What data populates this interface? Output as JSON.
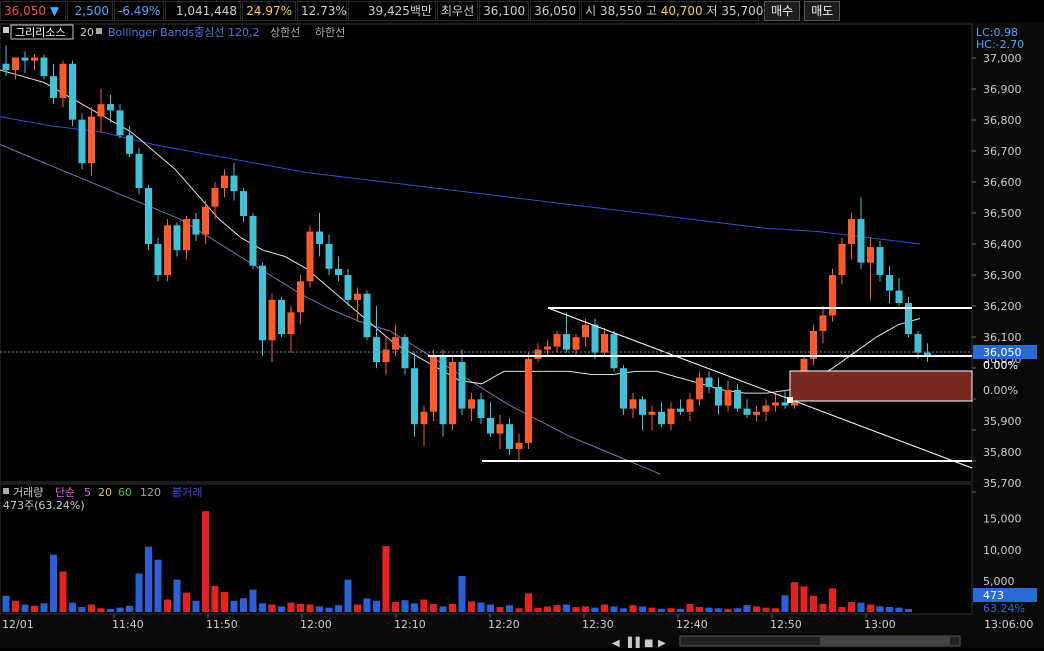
{
  "quote": {
    "price": "36,050",
    "arrow": "▼",
    "change": "2,500",
    "change_pct": "-6.49%",
    "volume": "1,041,448",
    "ratio1": "24.97%",
    "ratio2": "12.73%",
    "amount": "39,425백만",
    "best_label": "최우선",
    "best_ask": "36,100",
    "best_bid": "36,050",
    "open_label": "시",
    "open": "38,550",
    "high_label": "고",
    "high": "40,700",
    "low_label": "저",
    "low": "35,700",
    "buy_button": "매수",
    "sell_button": "매도"
  },
  "indicator_bar": {
    "menu_icon": "square-menu-icon",
    "name": "그리리소스",
    "period": "20",
    "bollinger_label": "Bollinger Bands중심선 120,2",
    "upper_label": "상한선",
    "lower_label": "하한선"
  },
  "right_info": {
    "lc": "LC:0.98",
    "hc": "HC:-2.70"
  },
  "price_axis": [
    "37,000",
    "36,900",
    "36,800",
    "36,700",
    "36,600",
    "36,500",
    "36,400",
    "36,300",
    "36,200",
    "36,100",
    "36,050",
    "0.00%",
    "35,900",
    "35,800",
    "35,700"
  ],
  "current_price_tag": "36,050",
  "current_pct_tag": "0.00%",
  "volume_panel": {
    "title": "거래량",
    "ma_label": "단순",
    "ma5": "5",
    "ma20": "20",
    "ma60": "60",
    "ma120": "120",
    "extra": "불거래",
    "current": "473주(63.24%)",
    "axis": [
      "15,000",
      "10,000",
      "5,000"
    ],
    "tag_value": "473",
    "tag_pct": "63.24%"
  },
  "time_axis": [
    "12/01",
    "11:40",
    "11:50",
    "12:00",
    "12:10",
    "12:20",
    "12:30",
    "12:40",
    "12:50",
    "13:00",
    "13:06:00"
  ],
  "colors": {
    "up": "#ff5a2a",
    "down": "#3ec4d8",
    "bb_mid": "#3050d0",
    "volume_down": "#2a60d8",
    "volume_up": "#e82020",
    "tag_blue": "#2a6ad8"
  },
  "chart_data": {
    "type": "candlestick",
    "y_range": [
      35650,
      37050
    ],
    "candles": [
      [
        36980,
        37040,
        36940,
        36960
      ],
      [
        36960,
        37000,
        36930,
        37000
      ],
      [
        37000,
        37020,
        36950,
        36990
      ],
      [
        36990,
        37010,
        36960,
        37000
      ],
      [
        37000,
        37010,
        36930,
        36940
      ],
      [
        36940,
        36980,
        36850,
        36870
      ],
      [
        36870,
        36990,
        36840,
        36980
      ],
      [
        36980,
        36990,
        36780,
        36800
      ],
      [
        36800,
        36820,
        36640,
        36660
      ],
      [
        36660,
        36840,
        36620,
        36810
      ],
      [
        36810,
        36900,
        36760,
        36850
      ],
      [
        36850,
        36880,
        36790,
        36830
      ],
      [
        36830,
        36850,
        36740,
        36750
      ],
      [
        36750,
        36780,
        36680,
        36690
      ],
      [
        36690,
        36710,
        36560,
        36580
      ],
      [
        36580,
        36590,
        36380,
        36400
      ],
      [
        36400,
        36420,
        36280,
        36300
      ],
      [
        36300,
        36480,
        36280,
        36460
      ],
      [
        36460,
        36470,
        36360,
        36380
      ],
      [
        36380,
        36490,
        36350,
        36480
      ],
      [
        36480,
        36500,
        36410,
        36430
      ],
      [
        36430,
        36540,
        36400,
        36520
      ],
      [
        36520,
        36600,
        36480,
        36580
      ],
      [
        36580,
        36640,
        36550,
        36620
      ],
      [
        36620,
        36660,
        36540,
        36570
      ],
      [
        36570,
        36580,
        36470,
        36490
      ],
      [
        36490,
        36500,
        36320,
        36330
      ],
      [
        36330,
        36340,
        36040,
        36090
      ],
      [
        36090,
        36240,
        36020,
        36220
      ],
      [
        36220,
        36230,
        36100,
        36110
      ],
      [
        36110,
        36200,
        36050,
        36180
      ],
      [
        36180,
        36300,
        36140,
        36280
      ],
      [
        36280,
        36460,
        36260,
        36440
      ],
      [
        36440,
        36500,
        36360,
        36400
      ],
      [
        36400,
        36430,
        36300,
        36320
      ],
      [
        36320,
        36360,
        36280,
        36300
      ],
      [
        36300,
        36320,
        36200,
        36220
      ],
      [
        36220,
        36260,
        36150,
        36240
      ],
      [
        36240,
        36250,
        36090,
        36100
      ],
      [
        36100,
        36200,
        36000,
        36020
      ],
      [
        36020,
        36100,
        35980,
        36060
      ],
      [
        36060,
        36140,
        36040,
        36100
      ],
      [
        36100,
        36110,
        35980,
        36000
      ],
      [
        36000,
        36050,
        35780,
        35820
      ],
      [
        35820,
        35880,
        35750,
        35860
      ],
      [
        35860,
        36060,
        35830,
        36040
      ],
      [
        36040,
        36060,
        35780,
        35820
      ],
      [
        35820,
        36040,
        35800,
        36020
      ],
      [
        36020,
        36060,
        35850,
        35870
      ],
      [
        35870,
        35920,
        35830,
        35900
      ],
      [
        35900,
        35920,
        35820,
        35840
      ],
      [
        35840,
        35890,
        35780,
        35790
      ],
      [
        35790,
        35850,
        35740,
        35820
      ],
      [
        35820,
        35840,
        35720,
        35740
      ],
      [
        35740,
        35790,
        35700,
        35760
      ],
      [
        35760,
        36050,
        35740,
        36030
      ],
      [
        36030,
        36080,
        36020,
        36060
      ],
      [
        36060,
        36090,
        36040,
        36070
      ],
      [
        36070,
        36120,
        36050,
        36110
      ],
      [
        36110,
        36180,
        36050,
        36060
      ],
      [
        36060,
        36110,
        36040,
        36100
      ],
      [
        36100,
        36160,
        36070,
        36140
      ],
      [
        36140,
        36160,
        36030,
        36050
      ],
      [
        36050,
        36130,
        36040,
        36110
      ],
      [
        36110,
        36120,
        35990,
        36000
      ],
      [
        36000,
        36010,
        35850,
        35870
      ],
      [
        35870,
        35920,
        35840,
        35900
      ],
      [
        35900,
        35910,
        35800,
        35850
      ],
      [
        35850,
        35880,
        35800,
        35860
      ],
      [
        35860,
        35890,
        35810,
        35820
      ],
      [
        35820,
        35890,
        35800,
        35870
      ],
      [
        35870,
        35900,
        35850,
        35860
      ],
      [
        35860,
        35920,
        35830,
        35900
      ],
      [
        35900,
        35990,
        35880,
        35970
      ],
      [
        35970,
        35990,
        35920,
        35940
      ],
      [
        35940,
        35970,
        35850,
        35880
      ],
      [
        35880,
        35960,
        35860,
        35930
      ],
      [
        35930,
        35950,
        35860,
        35870
      ],
      [
        35870,
        35900,
        35840,
        35850
      ],
      [
        35850,
        35880,
        35830,
        35860
      ],
      [
        35860,
        35900,
        35830,
        35880
      ],
      [
        35880,
        35920,
        35860,
        35890
      ],
      [
        35890,
        35930,
        35870,
        35880
      ],
      [
        35880,
        35960,
        35870,
        35940
      ],
      [
        35940,
        36040,
        35930,
        36030
      ],
      [
        36030,
        36140,
        36010,
        36120
      ],
      [
        36120,
        36200,
        36080,
        36170
      ],
      [
        36170,
        36320,
        36150,
        36300
      ],
      [
        36300,
        36420,
        36270,
        36400
      ],
      [
        36400,
        36500,
        36350,
        36480
      ],
      [
        36480,
        36550,
        36320,
        36340
      ],
      [
        36340,
        36420,
        36220,
        36390
      ],
      [
        36390,
        36410,
        36280,
        36300
      ],
      [
        36300,
        36330,
        36210,
        36250
      ],
      [
        36250,
        36290,
        36200,
        36210
      ],
      [
        36210,
        36230,
        36100,
        36110
      ],
      [
        36110,
        36120,
        36030,
        36050
      ],
      [
        36050,
        36080,
        36020,
        36040
      ]
    ],
    "volumes": [
      2600,
      1800,
      1200,
      1000,
      1400,
      9200,
      6500,
      1500,
      800,
      1200,
      600,
      500,
      700,
      1000,
      6200,
      10500,
      8400,
      2000,
      5200,
      3100,
      1800,
      16200,
      4200,
      3200,
      1800,
      2200,
      3600,
      1400,
      1200,
      900,
      1500,
      1300,
      1200,
      900,
      700,
      1100,
      5200,
      1200,
      2200,
      1800,
      10600,
      1600,
      1900,
      1400,
      2000,
      1300,
      900,
      1300,
      5800,
      1700,
      1500,
      1200,
      800,
      1100,
      600,
      3000,
      700,
      900,
      1100,
      1200,
      800,
      900,
      700,
      1200,
      900,
      600,
      1100,
      900,
      700,
      500,
      600,
      500,
      1300,
      800,
      700,
      600,
      500,
      600,
      1100,
      900,
      700,
      600,
      2700,
      4800,
      4100,
      2600,
      1300,
      3800,
      800,
      1600,
      1500,
      1200,
      900,
      800,
      700,
      473
    ],
    "bb_mid": [
      36810,
      36780,
      36760,
      36720,
      36690,
      36660,
      36630,
      36610,
      36590,
      36570,
      36550,
      36530,
      36510,
      36490,
      36470,
      36450,
      36440,
      36420,
      36400
    ],
    "ma_white": [
      36960,
      36940,
      36920,
      36880,
      36840,
      36800,
      36760,
      36700,
      36640,
      36560,
      36480,
      36420,
      36380,
      36360,
      36320,
      36260,
      36200,
      36140,
      36080,
      36040,
      36000,
      35960,
      35950,
      35990,
      35990,
      35990,
      35990,
      35980,
      35980,
      35990,
      35990,
      35970,
      35950,
      35930,
      35920,
      35920,
      35930,
      35960,
      36000,
      36050,
      36100,
      36140,
      36160
    ],
    "ma_purple": [
      36720,
      36680,
      36640,
      36600,
      36560,
      36520,
      36480,
      36420,
      36360,
      36300,
      36240,
      36190,
      36150,
      36120,
      36060,
      36000,
      35940,
      35880,
      35830,
      35780,
      35740,
      35700,
      35660
    ]
  }
}
